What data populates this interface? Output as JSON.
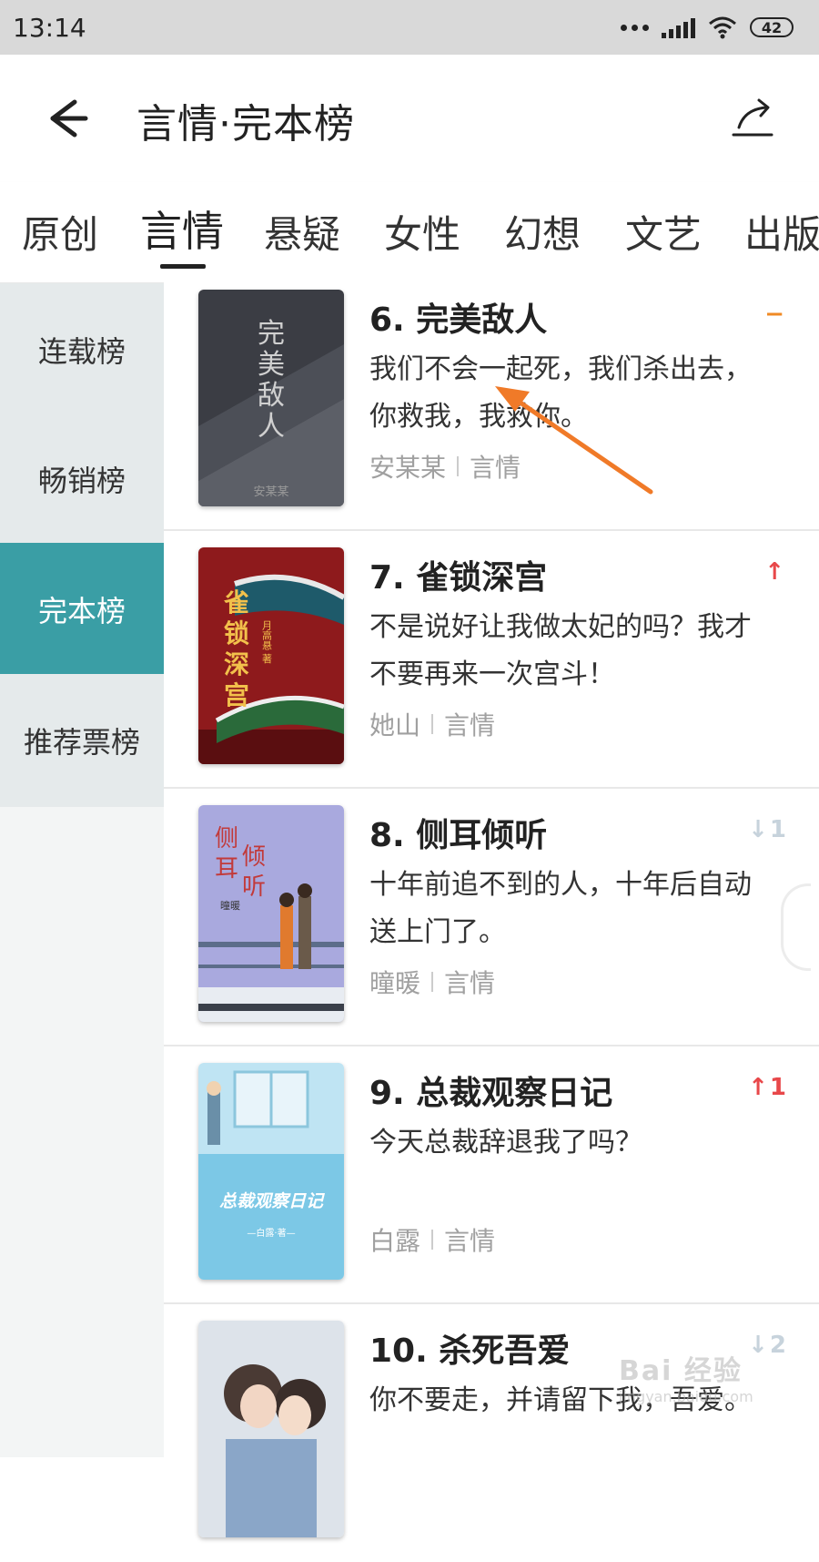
{
  "status": {
    "time": "13:14",
    "battery": "42"
  },
  "header": {
    "title": "言情·完本榜"
  },
  "tabs": [
    {
      "label": "原创"
    },
    {
      "label": "言情"
    },
    {
      "label": "悬疑"
    },
    {
      "label": "女性"
    },
    {
      "label": "幻想"
    },
    {
      "label": "文艺"
    },
    {
      "label": "出版"
    }
  ],
  "sidebar": [
    {
      "label": "连载榜"
    },
    {
      "label": "畅销榜"
    },
    {
      "label": "完本榜"
    },
    {
      "label": "推荐票榜"
    }
  ],
  "books": [
    {
      "title": "6. 完美敌人",
      "desc": "我们不会一起死，我们杀出去，你救我，我救你。",
      "author": "安某某",
      "genre": "言情",
      "trend_symbol": "−",
      "trend_value": "",
      "cover_text": "完美敌人",
      "cover_author": "安某某"
    },
    {
      "title": "7. 雀锁深宫",
      "desc": "不是说好让我做太妃的吗？我才不要再来一次宫斗！",
      "author": "她山",
      "genre": "言情",
      "trend_symbol": "↑",
      "trend_value": "",
      "cover_text": "雀锁深宫",
      "cover_author": "月高悬 著"
    },
    {
      "title": "8. 侧耳倾听",
      "desc": "十年前追不到的人，十年后自动送上门了。",
      "author": "曈暖",
      "genre": "言情",
      "trend_symbol": "↓",
      "trend_value": "1",
      "cover_text": "侧耳倾听",
      "cover_author": "曈暖"
    },
    {
      "title": "9. 总裁观察日记",
      "desc": "今天总裁辞退我了吗？",
      "author": "白露",
      "genre": "言情",
      "trend_symbol": "↑",
      "trend_value": "1",
      "cover_text": "总裁观察日记",
      "cover_author": "—白露·著—"
    },
    {
      "title": "10. 杀死吾爱",
      "desc": "你不要走，并请留下我，吾爱。",
      "author": "",
      "genre": "",
      "trend_symbol": "↓",
      "trend_value": "2",
      "cover_text": "",
      "cover_author": ""
    }
  ],
  "watermark": {
    "brand": "Bai 经验",
    "url": "jingyan.baidu.com"
  },
  "colors": {
    "accent": "#3a9ea5",
    "up": "#e8484a",
    "same": "#f08a24",
    "down": "#c7d3dc"
  }
}
